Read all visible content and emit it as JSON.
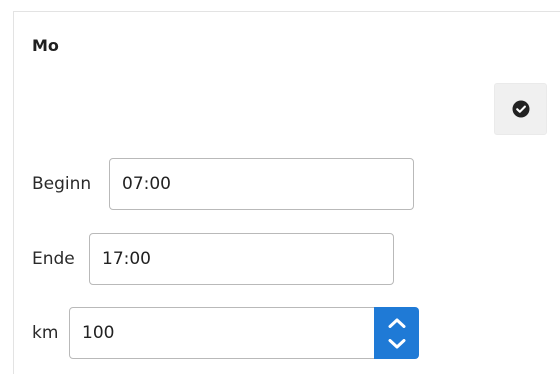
{
  "schedule": {
    "day_label": "Mo",
    "confirm_icon": "check-circle-icon",
    "fields": {
      "start": {
        "label": "Beginn",
        "value": "07:00"
      },
      "end": {
        "label": "Ende",
        "value": "17:00"
      },
      "km": {
        "label": "km",
        "value": "100"
      }
    },
    "spinner_icons": [
      "spin-up-icon",
      "spin-down-icon"
    ],
    "accent_color": "#1f7ad6"
  }
}
